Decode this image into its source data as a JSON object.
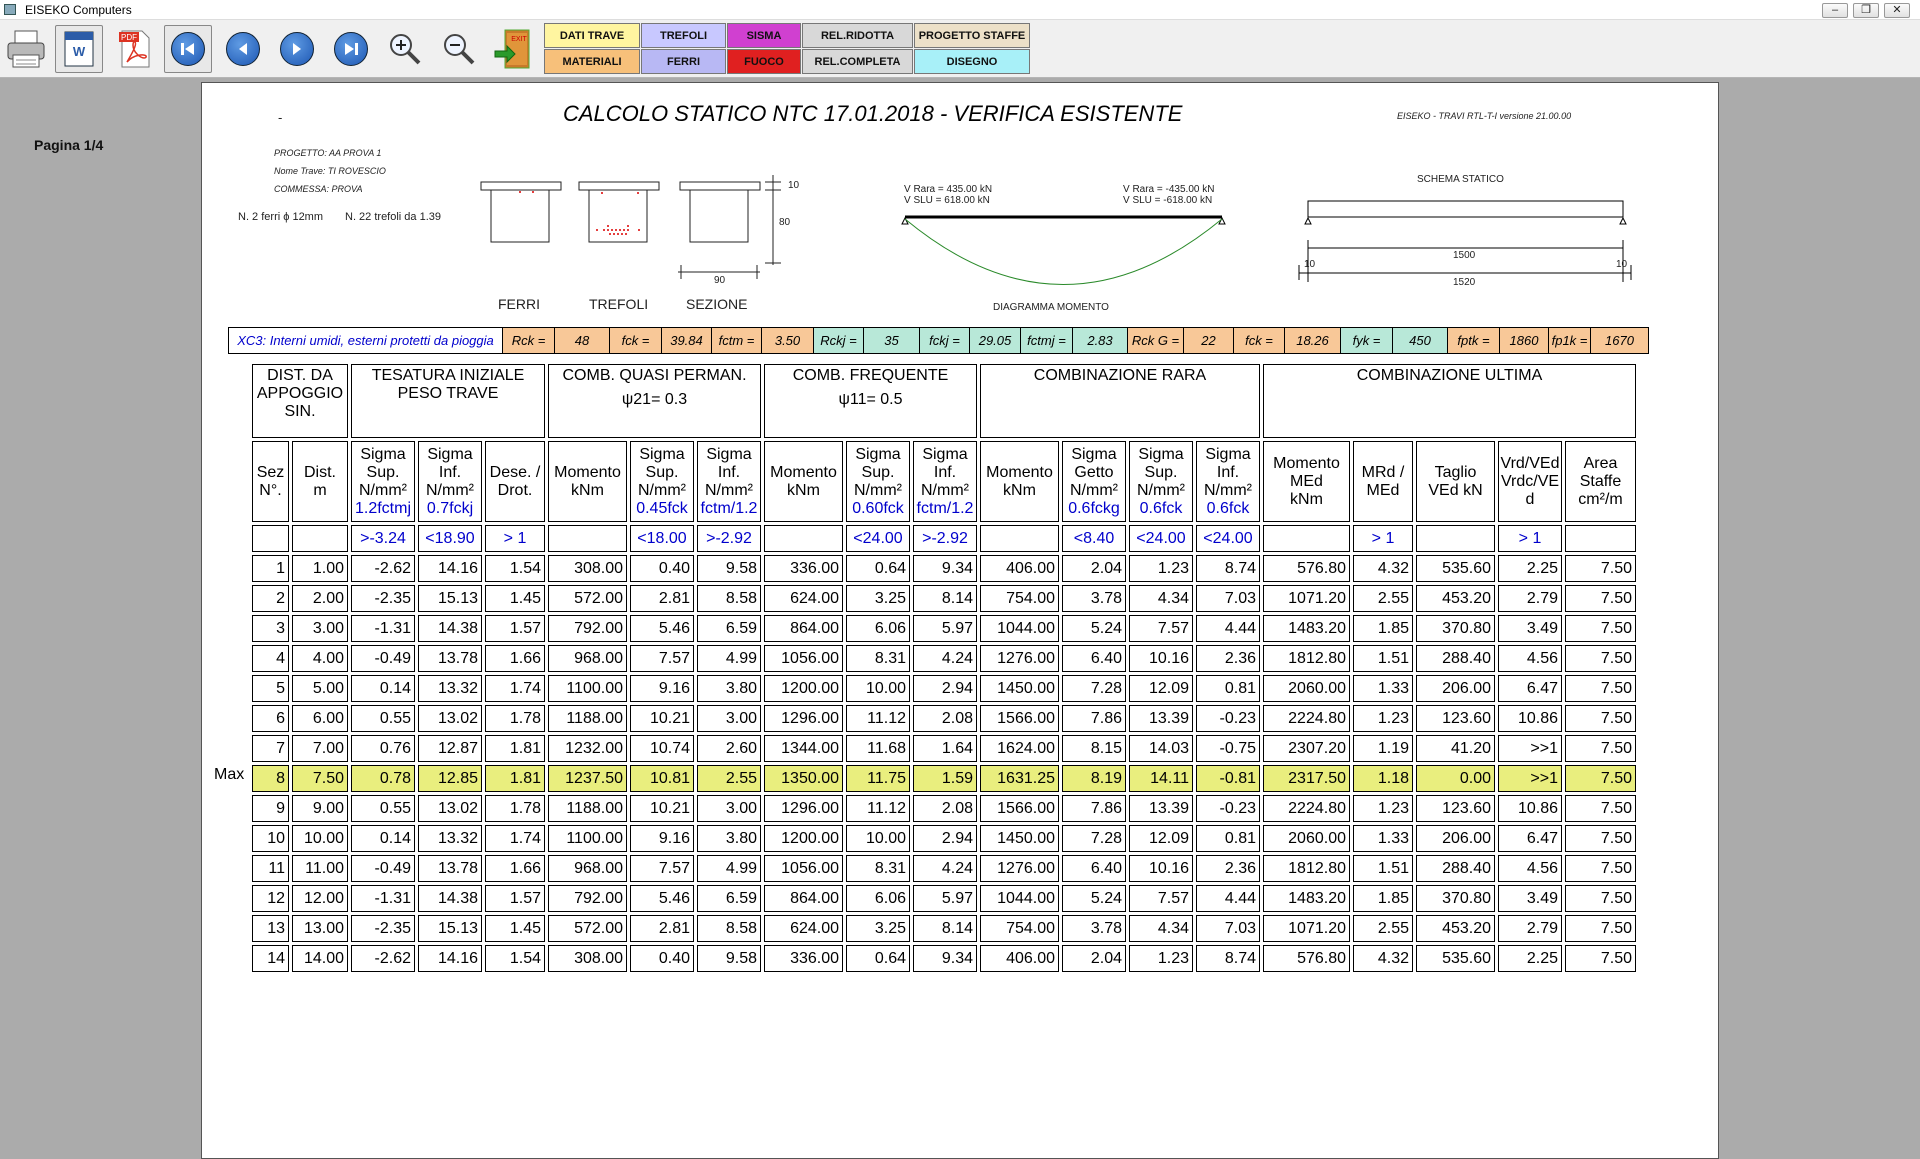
{
  "window": {
    "title": "EISEKO Computers"
  },
  "toolbar": {
    "icons": [
      "printer-icon",
      "word-icon",
      "pdf-icon",
      "first-page-icon",
      "previous-page-icon",
      "next-page-icon",
      "last-page-icon",
      "zoom-in-icon",
      "zoom-out-icon",
      "exit-icon"
    ],
    "buttons_row1": [
      {
        "label": "DATI TRAVE",
        "color": "#fff5a0"
      },
      {
        "label": "TREFOLI",
        "color": "#c8c8ff"
      },
      {
        "label": "SISMA",
        "color": "#d040d0"
      },
      {
        "label": "REL.RIDOTTA",
        "color": "#d8d8d8"
      },
      {
        "label": "PROGETTO STAFFE",
        "color": "#ece0c8"
      }
    ],
    "buttons_row2": [
      {
        "label": "MATERIALI",
        "color": "#f7c07a"
      },
      {
        "label": "FERRI",
        "color": "#b8b8f4"
      },
      {
        "label": "FUOCO",
        "color": "#e02020"
      },
      {
        "label": "REL.COMPLETA",
        "color": "#d8d8d8"
      },
      {
        "label": "DISEGNO",
        "color": "#a8f0f8"
      }
    ]
  },
  "page_label": "Pagina 1/4",
  "doc": {
    "dash": "-",
    "title": "CALCOLO STATICO NTC 17.01.2018 - VERIFICA ESISTENTE",
    "version": "EISEKO - TRAVI RTL-T-I  versione 21.00.00",
    "progetto": "PROGETTO: AA PROVA 1",
    "nome_trave": "Nome Trave: TI ROVESCIO",
    "commessa": "COMMESSA: PROVA",
    "ferri": "N. 2 ferri ϕ 12mm",
    "trefoli": "N. 22 trefoli da 1.39",
    "sec_labels": [
      "FERRI",
      "TREFOLI",
      "SEZIONE"
    ],
    "dim_top": "10",
    "dim_h": "80",
    "dim_b": "90",
    "v_left_rara": "V Rara = 435.00 kN",
    "v_left_slu": "V SLU = 618.00 kN",
    "v_right_rara": "V Rara = -435.00 kN",
    "v_right_slu": "V SLU = -618.00 kN",
    "diag_label": "DIAGRAMMA MOMENTO",
    "schema_label": "SCHEMA STATICO",
    "span_label": "1500",
    "total_label": "1520",
    "sup_left": "10",
    "sup_right": "10"
  },
  "materials": [
    {
      "t": "XC3: Interni umidi, esterni protetti da pioggia",
      "w": 275,
      "bg": "#ffffff",
      "blue": true
    },
    {
      "t": "Rck =",
      "w": 52,
      "bg": "#f8c898"
    },
    {
      "t": "48",
      "w": 55,
      "bg": "#f8c898"
    },
    {
      "t": "fck =",
      "w": 52,
      "bg": "#f8c898"
    },
    {
      "t": "39.84",
      "w": 50,
      "bg": "#f8c898"
    },
    {
      "t": "fctm =",
      "w": 50,
      "bg": "#f8c898"
    },
    {
      "t": "3.50",
      "w": 52,
      "bg": "#f8c898"
    },
    {
      "t": "Rckj =",
      "w": 50,
      "bg": "#b8e8d8"
    },
    {
      "t": "35",
      "w": 56,
      "bg": "#b8e8d8"
    },
    {
      "t": "fckj =",
      "w": 50,
      "bg": "#b8e8d8"
    },
    {
      "t": "29.05",
      "w": 51,
      "bg": "#b8e8d8"
    },
    {
      "t": "fctmj =",
      "w": 52,
      "bg": "#b8e8d8"
    },
    {
      "t": "2.83",
      "w": 55,
      "bg": "#b8e8d8"
    },
    {
      "t": "Rck G =",
      "w": 56,
      "bg": "#f8c898"
    },
    {
      "t": "22",
      "w": 50,
      "bg": "#f8c898"
    },
    {
      "t": "fck =",
      "w": 51,
      "bg": "#f8c898"
    },
    {
      "t": "18.26",
      "w": 56,
      "bg": "#f8c898"
    },
    {
      "t": "fyk =",
      "w": 52,
      "bg": "#b8e8d8"
    },
    {
      "t": "450",
      "w": 55,
      "bg": "#b8e8d8"
    },
    {
      "t": "fptk =",
      "w": 52,
      "bg": "#f8c898"
    },
    {
      "t": "1860",
      "w": 49,
      "bg": "#f8c898"
    },
    {
      "t": "fp1k =",
      "w": 42,
      "bg": "#f8c898"
    },
    {
      "t": "1670",
      "w": 58,
      "bg": "#f8c898"
    }
  ],
  "table": {
    "groups": [
      {
        "t": "DIST. DA\nAPPOGGIO\nSIN.",
        "span": 2
      },
      {
        "t": "TESATURA INIZIALE\nPESO TRAVE",
        "span": 3
      },
      {
        "t": "COMB. QUASI PERMAN.\nψ21= 0.3",
        "span": 3
      },
      {
        "t": "COMB.   FREQUENTE\nψ11= 0.5",
        "span": 3
      },
      {
        "t": "COMBINAZIONE  RARA",
        "span": 4
      },
      {
        "t": "COMBINAZIONE ULTIMA",
        "span": 5
      }
    ],
    "cols": [
      {
        "t": "Sez\nN°."
      },
      {
        "t": "Dist.\nm"
      },
      {
        "t": "Sigma\nSup.\nN/mm²",
        "u": "1.2fctmj"
      },
      {
        "t": "Sigma\nInf.\nN/mm²",
        "u": "0.7fckj"
      },
      {
        "t": "Dese. /\nDrot."
      },
      {
        "t": "Momento\nkNm"
      },
      {
        "t": "Sigma\nSup.\nN/mm²",
        "u": "0.45fck"
      },
      {
        "t": "Sigma\nInf.\nN/mm²",
        "u": "fctm/1.2"
      },
      {
        "t": "Momento\nkNm"
      },
      {
        "t": "Sigma\nSup.\nN/mm²",
        "u": "0.60fck"
      },
      {
        "t": "Sigma\nInf.\nN/mm²",
        "u": "fctm/1.2"
      },
      {
        "t": "Momento\nkNm"
      },
      {
        "t": "Sigma\nGetto\nN/mm²",
        "u": "0.6fckg"
      },
      {
        "t": "Sigma\nSup.\nN/mm²",
        "u": "0.6fck"
      },
      {
        "t": "Sigma\nInf.\nN/mm²",
        "u": "0.6fck"
      },
      {
        "t": "Momento\nMEd\nkNm"
      },
      {
        "t": "MRd /\nMEd"
      },
      {
        "t": "Taglio\nVEd    kN"
      },
      {
        "t": "Vrd/VEd\nVrdc/VE\nd"
      },
      {
        "t": "Area\nStaffe\ncm²/m"
      }
    ],
    "limits": [
      "",
      "",
      ">-3.24",
      "<18.90",
      "> 1",
      "",
      "<18.00",
      ">-2.92",
      "",
      "<24.00",
      ">-2.92",
      "",
      "<8.40",
      "<24.00",
      "<24.00",
      "",
      "> 1",
      "",
      "> 1",
      ""
    ],
    "max_label": "Max",
    "max_row": 7,
    "rows": [
      [
        "1",
        "1.00",
        "-2.62",
        "14.16",
        "1.54",
        "308.00",
        "0.40",
        "9.58",
        "336.00",
        "0.64",
        "9.34",
        "406.00",
        "2.04",
        "1.23",
        "8.74",
        "576.80",
        "4.32",
        "535.60",
        "2.25",
        "7.50"
      ],
      [
        "2",
        "2.00",
        "-2.35",
        "15.13",
        "1.45",
        "572.00",
        "2.81",
        "8.58",
        "624.00",
        "3.25",
        "8.14",
        "754.00",
        "3.78",
        "4.34",
        "7.03",
        "1071.20",
        "2.55",
        "453.20",
        "2.79",
        "7.50"
      ],
      [
        "3",
        "3.00",
        "-1.31",
        "14.38",
        "1.57",
        "792.00",
        "5.46",
        "6.59",
        "864.00",
        "6.06",
        "5.97",
        "1044.00",
        "5.24",
        "7.57",
        "4.44",
        "1483.20",
        "1.85",
        "370.80",
        "3.49",
        "7.50"
      ],
      [
        "4",
        "4.00",
        "-0.49",
        "13.78",
        "1.66",
        "968.00",
        "7.57",
        "4.99",
        "1056.00",
        "8.31",
        "4.24",
        "1276.00",
        "6.40",
        "10.16",
        "2.36",
        "1812.80",
        "1.51",
        "288.40",
        "4.56",
        "7.50"
      ],
      [
        "5",
        "5.00",
        "0.14",
        "13.32",
        "1.74",
        "1100.00",
        "9.16",
        "3.80",
        "1200.00",
        "10.00",
        "2.94",
        "1450.00",
        "7.28",
        "12.09",
        "0.81",
        "2060.00",
        "1.33",
        "206.00",
        "6.47",
        "7.50"
      ],
      [
        "6",
        "6.00",
        "0.55",
        "13.02",
        "1.78",
        "1188.00",
        "10.21",
        "3.00",
        "1296.00",
        "11.12",
        "2.08",
        "1566.00",
        "7.86",
        "13.39",
        "-0.23",
        "2224.80",
        "1.23",
        "123.60",
        "10.86",
        "7.50"
      ],
      [
        "7",
        "7.00",
        "0.76",
        "12.87",
        "1.81",
        "1232.00",
        "10.74",
        "2.60",
        "1344.00",
        "11.68",
        "1.64",
        "1624.00",
        "8.15",
        "14.03",
        "-0.75",
        "2307.20",
        "1.19",
        "41.20",
        ">>1",
        "7.50"
      ],
      [
        "8",
        "7.50",
        "0.78",
        "12.85",
        "1.81",
        "1237.50",
        "10.81",
        "2.55",
        "1350.00",
        "11.75",
        "1.59",
        "1631.25",
        "8.19",
        "14.11",
        "-0.81",
        "2317.50",
        "1.18",
        "0.00",
        ">>1",
        "7.50"
      ],
      [
        "9",
        "9.00",
        "0.55",
        "13.02",
        "1.78",
        "1188.00",
        "10.21",
        "3.00",
        "1296.00",
        "11.12",
        "2.08",
        "1566.00",
        "7.86",
        "13.39",
        "-0.23",
        "2224.80",
        "1.23",
        "123.60",
        "10.86",
        "7.50"
      ],
      [
        "10",
        "10.00",
        "0.14",
        "13.32",
        "1.74",
        "1100.00",
        "9.16",
        "3.80",
        "1200.00",
        "10.00",
        "2.94",
        "1450.00",
        "7.28",
        "12.09",
        "0.81",
        "2060.00",
        "1.33",
        "206.00",
        "6.47",
        "7.50"
      ],
      [
        "11",
        "11.00",
        "-0.49",
        "13.78",
        "1.66",
        "968.00",
        "7.57",
        "4.99",
        "1056.00",
        "8.31",
        "4.24",
        "1276.00",
        "6.40",
        "10.16",
        "2.36",
        "1812.80",
        "1.51",
        "288.40",
        "4.56",
        "7.50"
      ],
      [
        "12",
        "12.00",
        "-1.31",
        "14.38",
        "1.57",
        "792.00",
        "5.46",
        "6.59",
        "864.00",
        "6.06",
        "5.97",
        "1044.00",
        "5.24",
        "7.57",
        "4.44",
        "1483.20",
        "1.85",
        "370.80",
        "3.49",
        "7.50"
      ],
      [
        "13",
        "13.00",
        "-2.35",
        "15.13",
        "1.45",
        "572.00",
        "2.81",
        "8.58",
        "624.00",
        "3.25",
        "8.14",
        "754.00",
        "3.78",
        "4.34",
        "7.03",
        "1071.20",
        "2.55",
        "453.20",
        "2.79",
        "7.50"
      ],
      [
        "14",
        "14.00",
        "-2.62",
        "14.16",
        "1.54",
        "308.00",
        "0.40",
        "9.58",
        "336.00",
        "0.64",
        "9.34",
        "406.00",
        "2.04",
        "1.23",
        "8.74",
        "576.80",
        "4.32",
        "535.60",
        "2.25",
        "7.50"
      ]
    ]
  }
}
